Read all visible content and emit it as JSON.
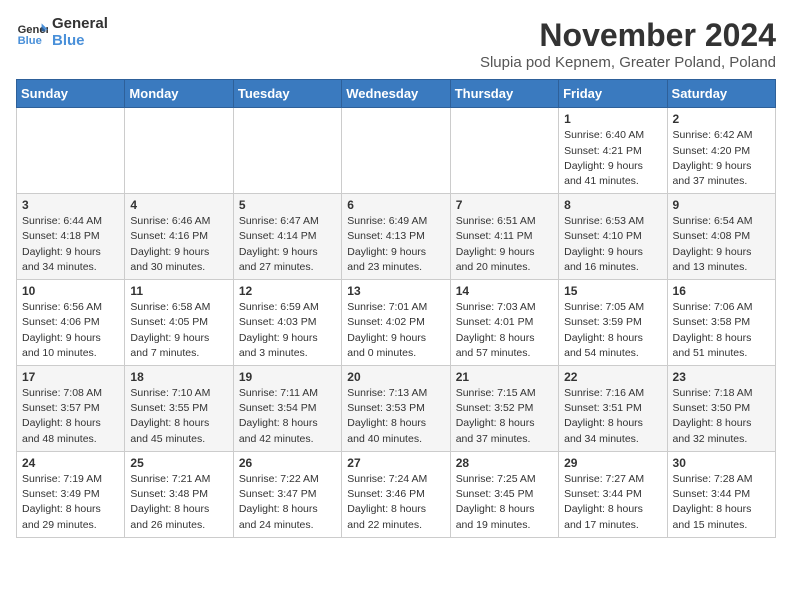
{
  "logo": {
    "line1": "General",
    "line2": "Blue"
  },
  "title": "November 2024",
  "location": "Slupia pod Kepnem, Greater Poland, Poland",
  "days_header": [
    "Sunday",
    "Monday",
    "Tuesday",
    "Wednesday",
    "Thursday",
    "Friday",
    "Saturday"
  ],
  "weeks": [
    [
      {
        "day": "",
        "info": ""
      },
      {
        "day": "",
        "info": ""
      },
      {
        "day": "",
        "info": ""
      },
      {
        "day": "",
        "info": ""
      },
      {
        "day": "",
        "info": ""
      },
      {
        "day": "1",
        "info": "Sunrise: 6:40 AM\nSunset: 4:21 PM\nDaylight: 9 hours\nand 41 minutes."
      },
      {
        "day": "2",
        "info": "Sunrise: 6:42 AM\nSunset: 4:20 PM\nDaylight: 9 hours\nand 37 minutes."
      }
    ],
    [
      {
        "day": "3",
        "info": "Sunrise: 6:44 AM\nSunset: 4:18 PM\nDaylight: 9 hours\nand 34 minutes."
      },
      {
        "day": "4",
        "info": "Sunrise: 6:46 AM\nSunset: 4:16 PM\nDaylight: 9 hours\nand 30 minutes."
      },
      {
        "day": "5",
        "info": "Sunrise: 6:47 AM\nSunset: 4:14 PM\nDaylight: 9 hours\nand 27 minutes."
      },
      {
        "day": "6",
        "info": "Sunrise: 6:49 AM\nSunset: 4:13 PM\nDaylight: 9 hours\nand 23 minutes."
      },
      {
        "day": "7",
        "info": "Sunrise: 6:51 AM\nSunset: 4:11 PM\nDaylight: 9 hours\nand 20 minutes."
      },
      {
        "day": "8",
        "info": "Sunrise: 6:53 AM\nSunset: 4:10 PM\nDaylight: 9 hours\nand 16 minutes."
      },
      {
        "day": "9",
        "info": "Sunrise: 6:54 AM\nSunset: 4:08 PM\nDaylight: 9 hours\nand 13 minutes."
      }
    ],
    [
      {
        "day": "10",
        "info": "Sunrise: 6:56 AM\nSunset: 4:06 PM\nDaylight: 9 hours\nand 10 minutes."
      },
      {
        "day": "11",
        "info": "Sunrise: 6:58 AM\nSunset: 4:05 PM\nDaylight: 9 hours\nand 7 minutes."
      },
      {
        "day": "12",
        "info": "Sunrise: 6:59 AM\nSunset: 4:03 PM\nDaylight: 9 hours\nand 3 minutes."
      },
      {
        "day": "13",
        "info": "Sunrise: 7:01 AM\nSunset: 4:02 PM\nDaylight: 9 hours\nand 0 minutes."
      },
      {
        "day": "14",
        "info": "Sunrise: 7:03 AM\nSunset: 4:01 PM\nDaylight: 8 hours\nand 57 minutes."
      },
      {
        "day": "15",
        "info": "Sunrise: 7:05 AM\nSunset: 3:59 PM\nDaylight: 8 hours\nand 54 minutes."
      },
      {
        "day": "16",
        "info": "Sunrise: 7:06 AM\nSunset: 3:58 PM\nDaylight: 8 hours\nand 51 minutes."
      }
    ],
    [
      {
        "day": "17",
        "info": "Sunrise: 7:08 AM\nSunset: 3:57 PM\nDaylight: 8 hours\nand 48 minutes."
      },
      {
        "day": "18",
        "info": "Sunrise: 7:10 AM\nSunset: 3:55 PM\nDaylight: 8 hours\nand 45 minutes."
      },
      {
        "day": "19",
        "info": "Sunrise: 7:11 AM\nSunset: 3:54 PM\nDaylight: 8 hours\nand 42 minutes."
      },
      {
        "day": "20",
        "info": "Sunrise: 7:13 AM\nSunset: 3:53 PM\nDaylight: 8 hours\nand 40 minutes."
      },
      {
        "day": "21",
        "info": "Sunrise: 7:15 AM\nSunset: 3:52 PM\nDaylight: 8 hours\nand 37 minutes."
      },
      {
        "day": "22",
        "info": "Sunrise: 7:16 AM\nSunset: 3:51 PM\nDaylight: 8 hours\nand 34 minutes."
      },
      {
        "day": "23",
        "info": "Sunrise: 7:18 AM\nSunset: 3:50 PM\nDaylight: 8 hours\nand 32 minutes."
      }
    ],
    [
      {
        "day": "24",
        "info": "Sunrise: 7:19 AM\nSunset: 3:49 PM\nDaylight: 8 hours\nand 29 minutes."
      },
      {
        "day": "25",
        "info": "Sunrise: 7:21 AM\nSunset: 3:48 PM\nDaylight: 8 hours\nand 26 minutes."
      },
      {
        "day": "26",
        "info": "Sunrise: 7:22 AM\nSunset: 3:47 PM\nDaylight: 8 hours\nand 24 minutes."
      },
      {
        "day": "27",
        "info": "Sunrise: 7:24 AM\nSunset: 3:46 PM\nDaylight: 8 hours\nand 22 minutes."
      },
      {
        "day": "28",
        "info": "Sunrise: 7:25 AM\nSunset: 3:45 PM\nDaylight: 8 hours\nand 19 minutes."
      },
      {
        "day": "29",
        "info": "Sunrise: 7:27 AM\nSunset: 3:44 PM\nDaylight: 8 hours\nand 17 minutes."
      },
      {
        "day": "30",
        "info": "Sunrise: 7:28 AM\nSunset: 3:44 PM\nDaylight: 8 hours\nand 15 minutes."
      }
    ]
  ]
}
